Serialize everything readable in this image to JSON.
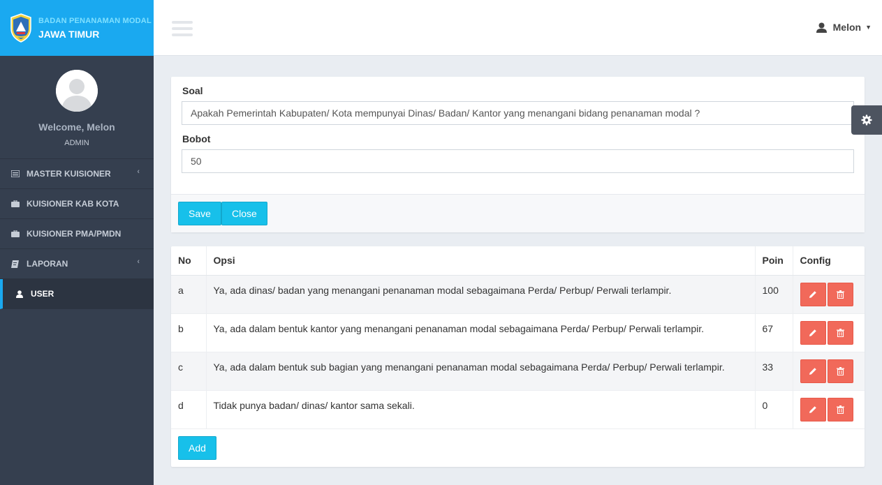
{
  "brand": {
    "line1": "BADAN PENANAMAN MODAL",
    "line2": "JAWA TIMUR"
  },
  "profile": {
    "welcome": "Welcome, Melon",
    "role": "ADMIN"
  },
  "sidebar": {
    "items": [
      {
        "label": "MASTER KUISIONER",
        "icon": "list-icon",
        "has_chevron": true
      },
      {
        "label": "KUISIONER KAB KOTA",
        "icon": "briefcase-icon",
        "has_chevron": false
      },
      {
        "label": "KUISIONER PMA/PMDN",
        "icon": "briefcase-icon",
        "has_chevron": false
      },
      {
        "label": "LAPORAN",
        "icon": "book-icon",
        "has_chevron": true
      },
      {
        "label": "USER",
        "icon": "user-icon",
        "has_chevron": false,
        "active": true
      }
    ]
  },
  "topbar": {
    "user_name": "Melon"
  },
  "form": {
    "soal_label": "Soal",
    "soal_value": "Apakah Pemerintah Kabupaten/ Kota mempunyai Dinas/ Badan/ Kantor yang menangani bidang penanaman modal ?",
    "bobot_label": "Bobot",
    "bobot_value": "50",
    "save_label": "Save",
    "close_label": "Close"
  },
  "table": {
    "headers": {
      "no": "No",
      "opsi": "Opsi",
      "poin": "Poin",
      "config": "Config"
    },
    "rows": [
      {
        "no": "a",
        "opsi": "Ya, ada dinas/ badan yang menangani penanaman modal sebagaimana Perda/ Perbup/ Perwali terlampir.",
        "poin": "100"
      },
      {
        "no": "b",
        "opsi": "Ya, ada dalam bentuk kantor yang menangani penanaman modal sebagaimana Perda/ Perbup/ Perwali terlampir.",
        "poin": "67"
      },
      {
        "no": "c",
        "opsi": "Ya, ada dalam bentuk sub bagian yang menangani penanaman modal sebagaimana Perda/ Perbup/ Perwali terlampir.",
        "poin": "33"
      },
      {
        "no": "d",
        "opsi": "Tidak punya badan/ dinas/ kantor sama sekali.",
        "poin": "0"
      }
    ],
    "add_label": "Add"
  },
  "colors": {
    "brand": "#1aa9f0",
    "sidebar": "#353f4f",
    "primary_button": "#17c0ea",
    "danger_button": "#f1695a"
  }
}
